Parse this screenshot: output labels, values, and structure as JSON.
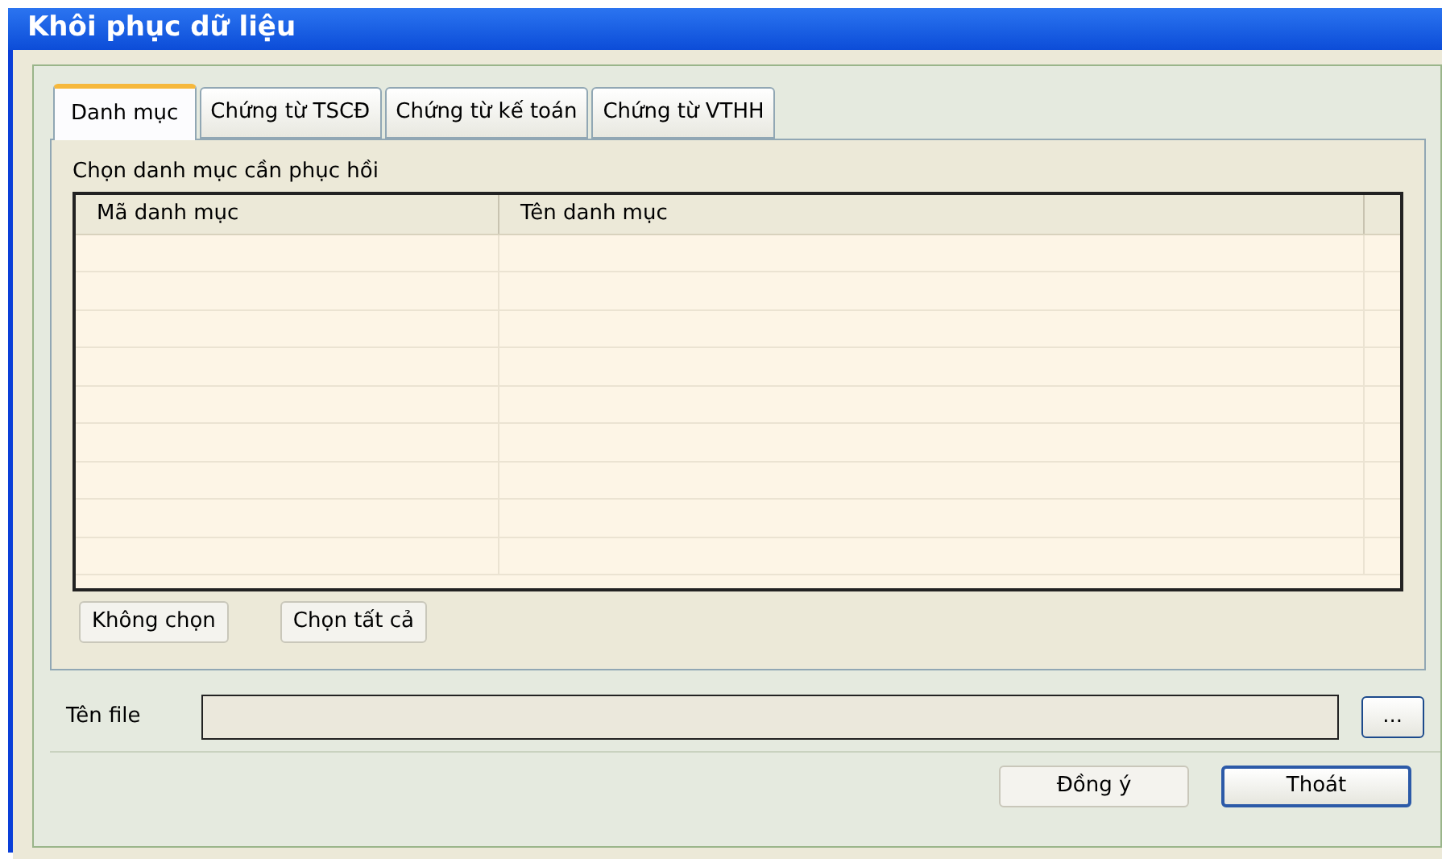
{
  "window": {
    "title": "Khôi phục dữ liệu"
  },
  "tabs": [
    {
      "label": "Danh mục",
      "selected": true
    },
    {
      "label": "Chứng từ TSCĐ",
      "selected": false
    },
    {
      "label": "Chứng từ kế toán",
      "selected": false
    },
    {
      "label": "Chứng từ VTHH",
      "selected": false
    }
  ],
  "panel": {
    "caption": "Chọn danh mục cần phục hồi",
    "table": {
      "columns": [
        "Mã danh mục",
        "Tên danh mục"
      ]
    },
    "buttons": [
      "Không chọn",
      "Chọn tất cả"
    ]
  },
  "file": {
    "label": "Tên file",
    "browse": "..."
  },
  "buttons": [
    {
      "label": "Đồng ý",
      "default": false
    },
    {
      "label": "Thoát",
      "default": true
    }
  ]
}
